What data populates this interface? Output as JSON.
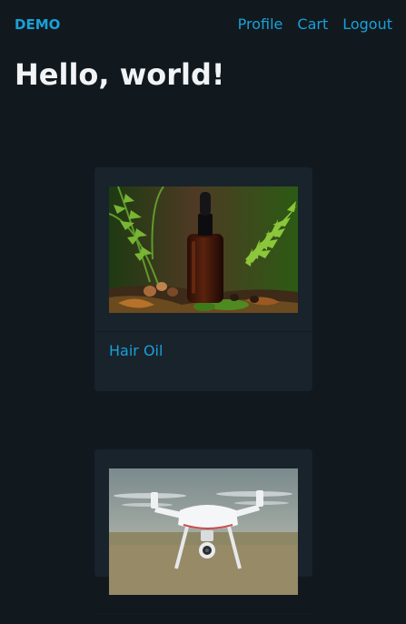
{
  "nav": {
    "brand": "DEMO",
    "links": [
      "Profile",
      "Cart",
      "Logout"
    ]
  },
  "page": {
    "title": "Hello, world!"
  },
  "products": [
    {
      "name": "Hair Oil",
      "image": "hair-oil-bottle-image"
    },
    {
      "name": "",
      "image": "drone-image"
    }
  ],
  "colors": {
    "background": "#11191f",
    "card": "#18232c",
    "accent": "#1aa0d7",
    "text": "#f1f3f5"
  }
}
